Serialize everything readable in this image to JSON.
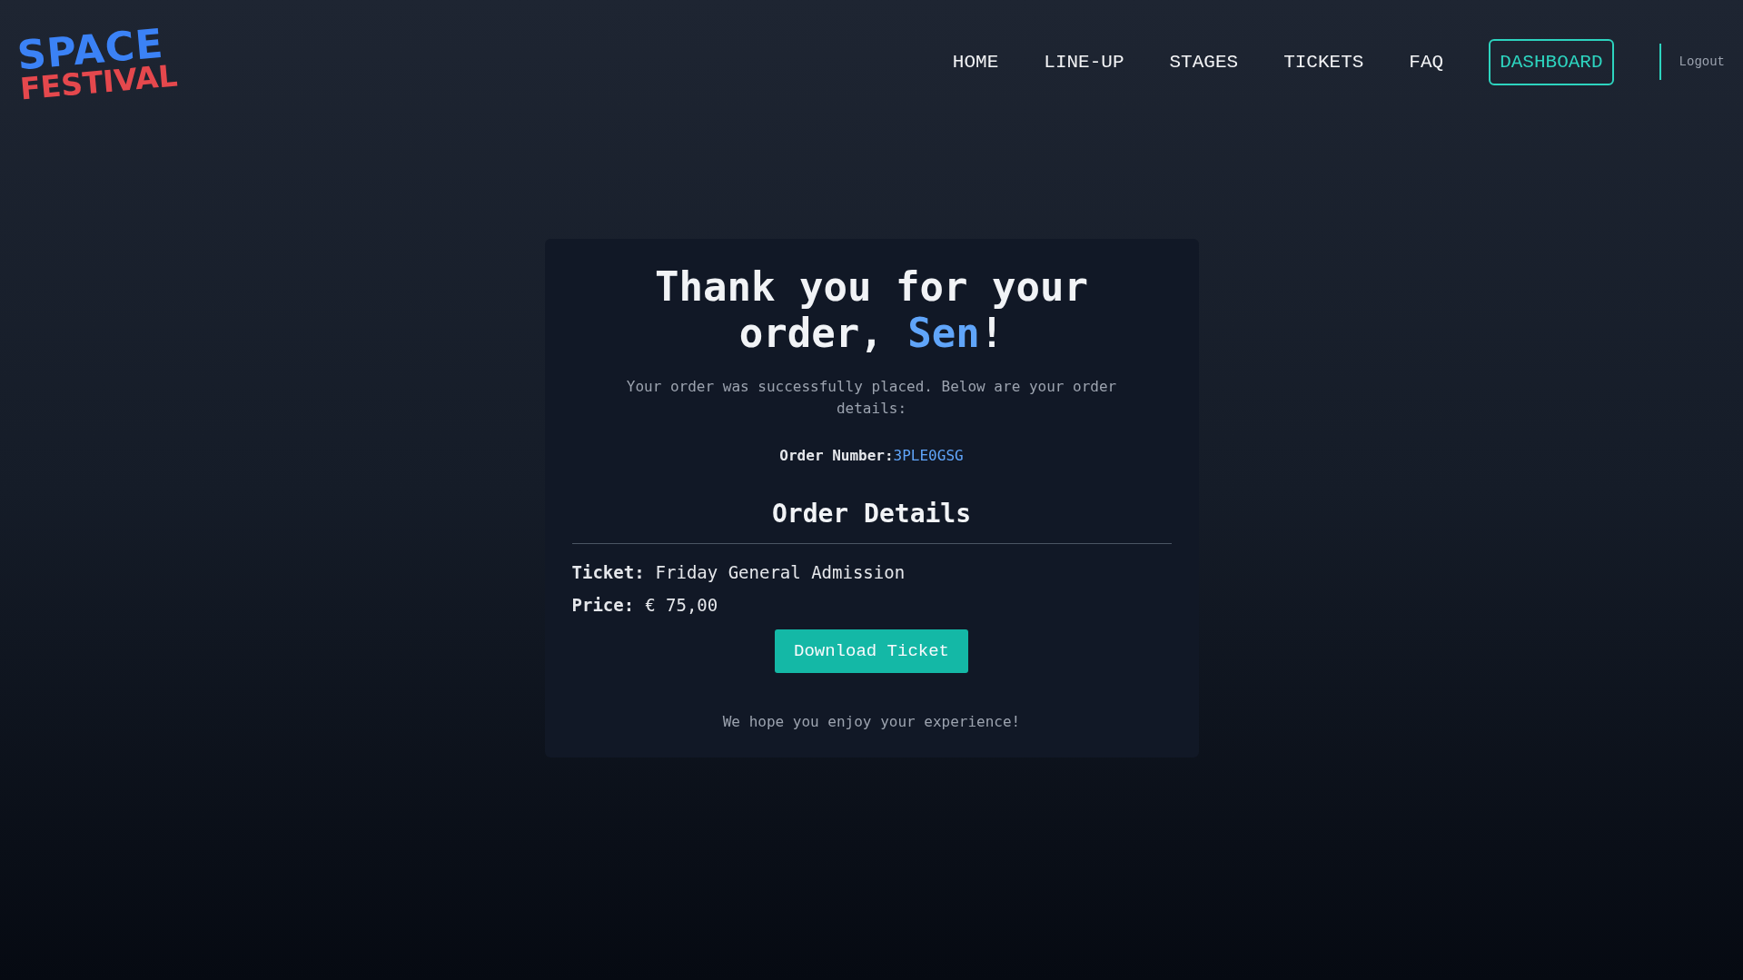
{
  "logo": {
    "line_1": "SPACE",
    "line_2": "FESTIVAL"
  },
  "nav": {
    "items": [
      {
        "label": "HOME",
        "kind": "link"
      },
      {
        "label": "LINE-UP",
        "kind": "link"
      },
      {
        "label": "STAGES",
        "kind": "link"
      },
      {
        "label": "TICKETS",
        "kind": "link"
      },
      {
        "label": "FAQ",
        "kind": "link"
      },
      {
        "label": "DASHBOARD",
        "kind": "outlined"
      }
    ],
    "logout": "Logout"
  },
  "card": {
    "heading": {
      "before": "Thank you for your order, ",
      "name": "Sen",
      "after": "!"
    },
    "message": "Your order was successfully placed. Below are your order details:",
    "order_number": {
      "label": "Order Number:",
      "value": "3PLE0GSG"
    },
    "section_title": "Order Details",
    "details": [
      {
        "label": "Ticket:",
        "value": "Friday General Admission"
      },
      {
        "label": "Price:",
        "value": "€ 75,00"
      }
    ],
    "button": "Download Ticket",
    "footer": "We hope you enjoy your experience!"
  }
}
